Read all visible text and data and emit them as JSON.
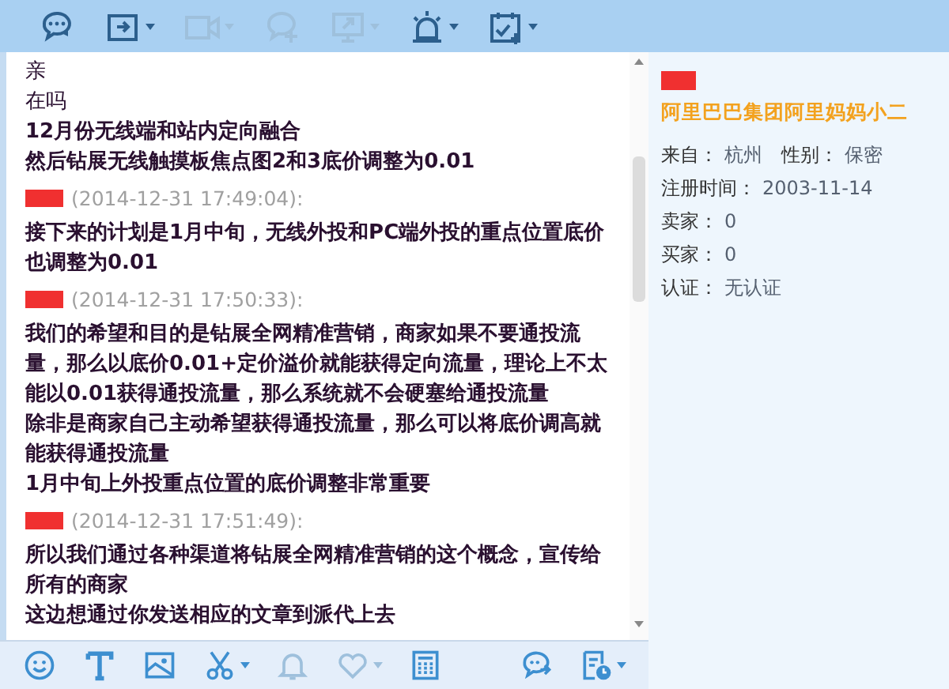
{
  "top_toolbar": [
    {
      "disabled": false,
      "menu": false
    },
    {
      "disabled": false,
      "menu": true
    },
    {
      "disabled": true,
      "menu": true
    },
    {
      "disabled": true,
      "menu": false
    },
    {
      "disabled": true,
      "menu": true
    },
    {
      "disabled": false,
      "menu": true
    },
    {
      "disabled": false,
      "menu": true
    }
  ],
  "messages": [
    {
      "lines": [
        {
          "text": "亲",
          "bold": false
        },
        {
          "text": "在吗",
          "bold": false
        },
        {
          "text": "12月份无线端和站内定向融合",
          "bold": true
        },
        {
          "text": "然后钻展无线触摸板焦点图2和3底价调整为0.01",
          "bold": true
        }
      ]
    },
    {
      "sender_redacted": true,
      "time": "(2014-12-31 17:49:04):",
      "lines": [
        {
          "text": "接下来的计划是1月中旬，无线外投和PC端外投的重点位置底价也调整为0.01",
          "bold": true
        }
      ]
    },
    {
      "sender_redacted": true,
      "time": "(2014-12-31 17:50:33):",
      "lines": [
        {
          "text": "我们的希望和目的是钻展全网精准营销，商家如果不要通投流量，那么以底价0.01+定价溢价就能获得定向流量，理论上不太能以0.01获得通投流量，那么系统就不会硬塞给通投流量",
          "bold": true
        },
        {
          "text": "除非是商家自己主动希望获得通投流量，那么可以将底价调高就能获得通投流量",
          "bold": true
        },
        {
          "text": "1月中旬上外投重点位置的底价调整非常重要",
          "bold": true
        }
      ]
    },
    {
      "sender_redacted": true,
      "time": "(2014-12-31 17:51:49):",
      "lines": [
        {
          "text": "所以我们通过各种渠道将钻展全网精准营销的这个概念，宣传给所有的商家",
          "bold": true
        },
        {
          "text": "这边想通过你发送相应的文章到派代上去",
          "bold": true
        }
      ]
    }
  ],
  "profile": {
    "name_redacted": true,
    "company": "阿里巴巴集团阿里妈妈小二",
    "rows": [
      [
        {
          "label": "来自：",
          "value": "杭州"
        },
        {
          "label": "性别：",
          "value": "保密"
        }
      ],
      [
        {
          "label": "注册时间：",
          "value": "2003-11-14"
        }
      ],
      [
        {
          "label": "卖家：",
          "value": "0"
        }
      ],
      [
        {
          "label": "买家：",
          "value": "0"
        }
      ],
      [
        {
          "label": "认证：",
          "value": "无认证"
        }
      ]
    ]
  },
  "bottom_toolbar": {
    "left": [
      {
        "disabled": false,
        "menu": false
      },
      {
        "disabled": false,
        "menu": false
      },
      {
        "disabled": false,
        "menu": false
      },
      {
        "disabled": false,
        "menu": true
      },
      {
        "disabled": true,
        "menu": false
      },
      {
        "disabled": true,
        "menu": true
      },
      {
        "disabled": false,
        "menu": false
      }
    ],
    "right": [
      {
        "disabled": false,
        "menu": false
      },
      {
        "disabled": false,
        "menu": true
      }
    ]
  }
}
